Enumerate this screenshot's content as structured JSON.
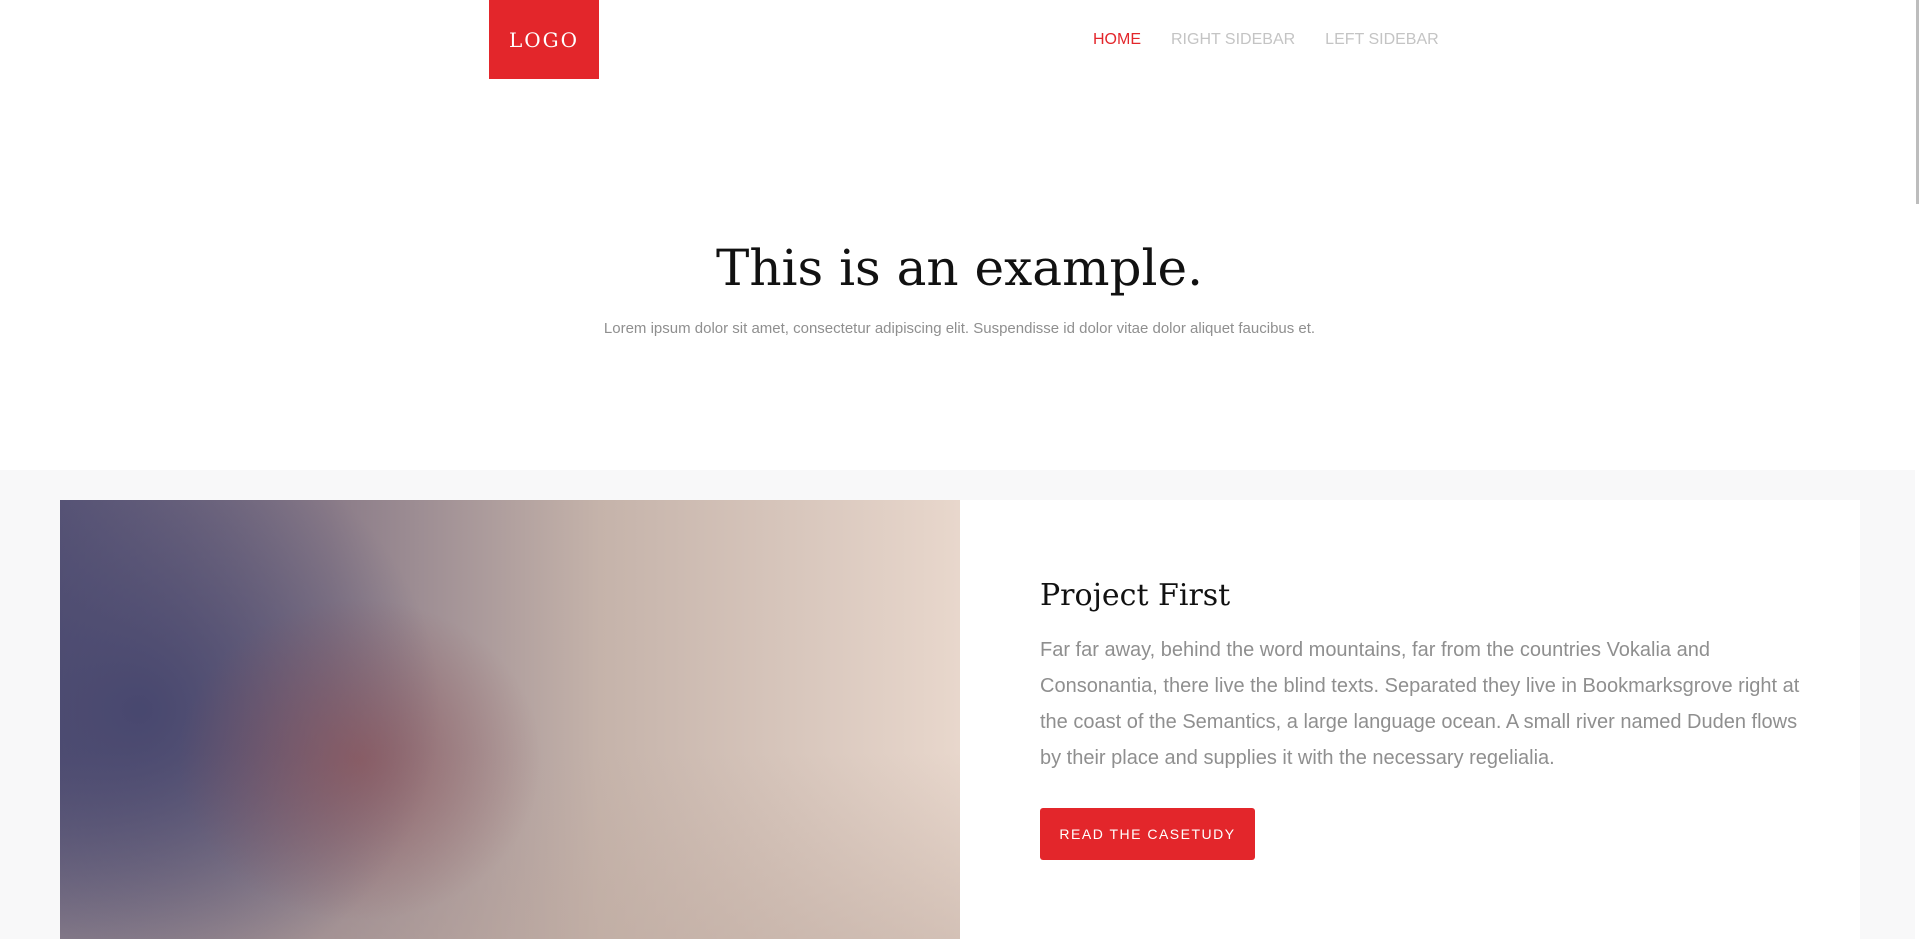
{
  "header": {
    "logo_text": "LOGO",
    "nav": [
      {
        "label": "HOME",
        "active": true
      },
      {
        "label": "RIGHT SIDEBAR",
        "active": false
      },
      {
        "label": "LEFT SIDEBAR",
        "active": false
      }
    ]
  },
  "hero": {
    "title": "This is an example.",
    "subtitle": "Lorem ipsum dolor sit amet, consectetur adipiscing elit. Suspendisse id dolor vitae dolor aliquet faucibus et."
  },
  "project": {
    "title": "Project First",
    "description": "Far far away, behind the word mountains, far from the countries Vokalia and Consonantia, there live the blind texts. Separated they live in Bookmarksgrove right at the coast of the Semantics, a large language ocean. A small river named Duden flows by their place and supplies it with the necessary regelialia.",
    "button_label": "READ THE CASETUDY"
  },
  "colors": {
    "accent": "#e3262b",
    "nav_inactive": "#c4c4c4",
    "body_text": "#8f8f8f",
    "section_bg": "#f8f8f9"
  }
}
